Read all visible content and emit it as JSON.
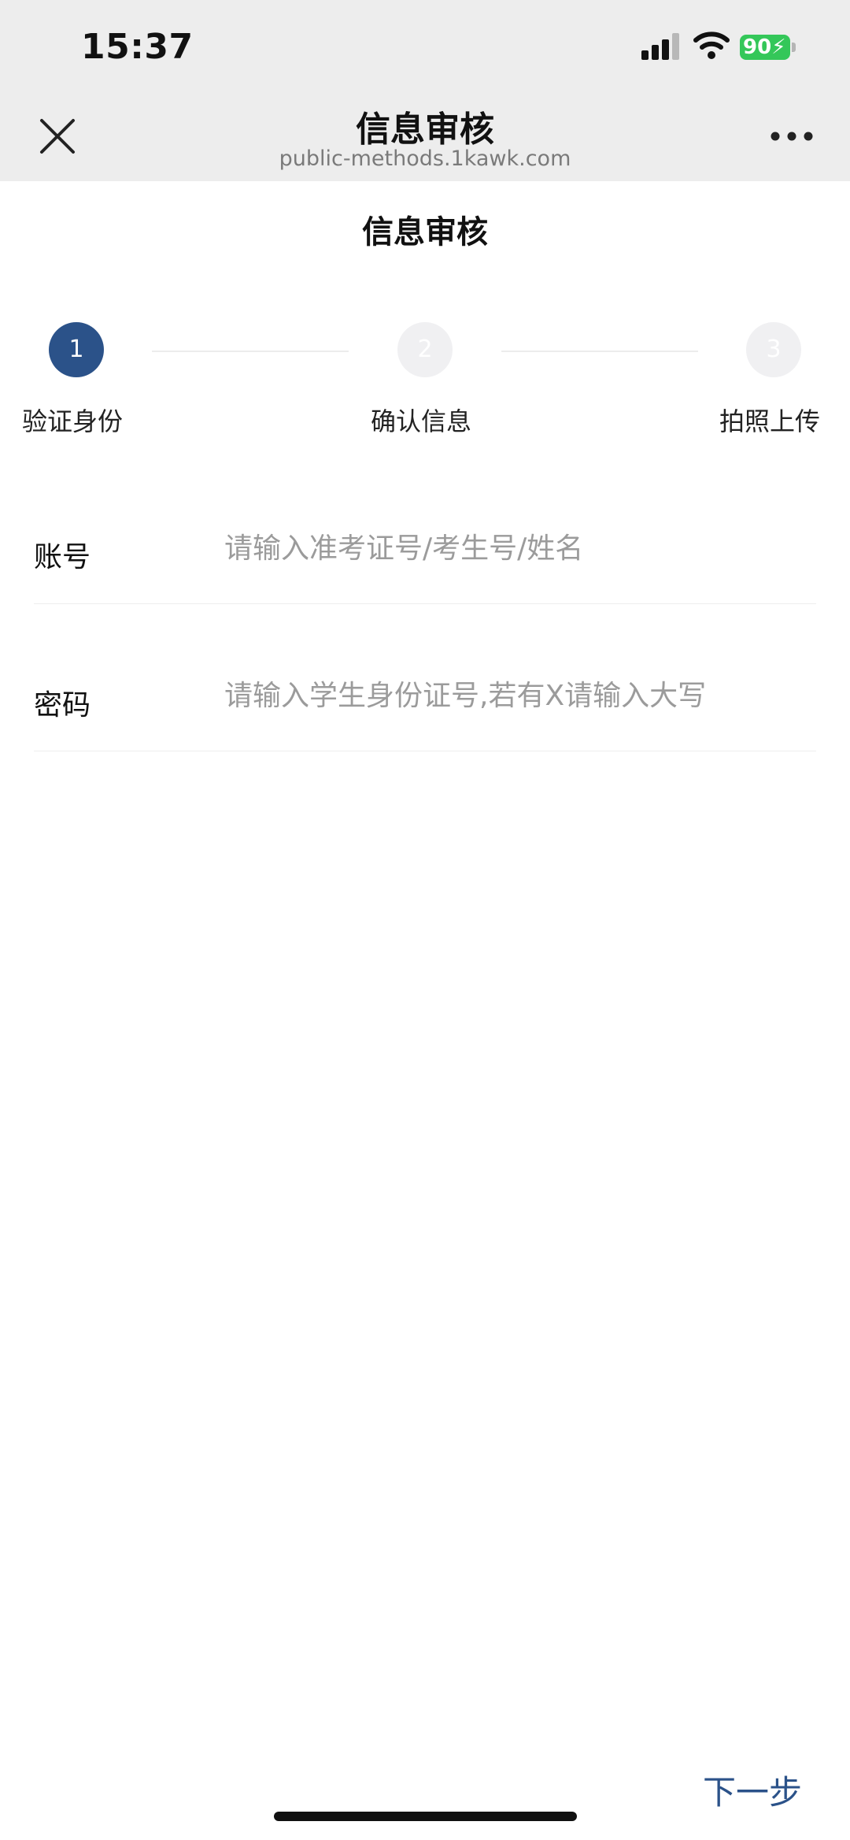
{
  "status_bar": {
    "time": "15:37",
    "battery": "90",
    "icons": [
      "signal-icon",
      "wifi-icon",
      "battery-charging-icon"
    ],
    "battery_color": "#34c759"
  },
  "browser": {
    "title": "信息审核",
    "url": "public-methods.1kawk.com",
    "icons": [
      "close-icon",
      "more-icon"
    ]
  },
  "page": {
    "title": "信息审核"
  },
  "steps": [
    {
      "number": "1",
      "label": "验证身份",
      "state": "active"
    },
    {
      "number": "2",
      "label": "确认信息",
      "state": "inactive"
    },
    {
      "number": "3",
      "label": "拍照上传",
      "state": "inactive"
    }
  ],
  "form": {
    "account": {
      "label": "账号",
      "value": "",
      "placeholder": "请输入准考证号/考生号/姓名"
    },
    "password": {
      "label": "密码",
      "value": "",
      "placeholder": "请输入学生身份证号,若有X请输入大写"
    }
  },
  "actions": {
    "next_label": "下一步"
  },
  "colors": {
    "accent": "#2b5289",
    "header_bg": "#ededed",
    "placeholder": "#9b9b9b"
  }
}
